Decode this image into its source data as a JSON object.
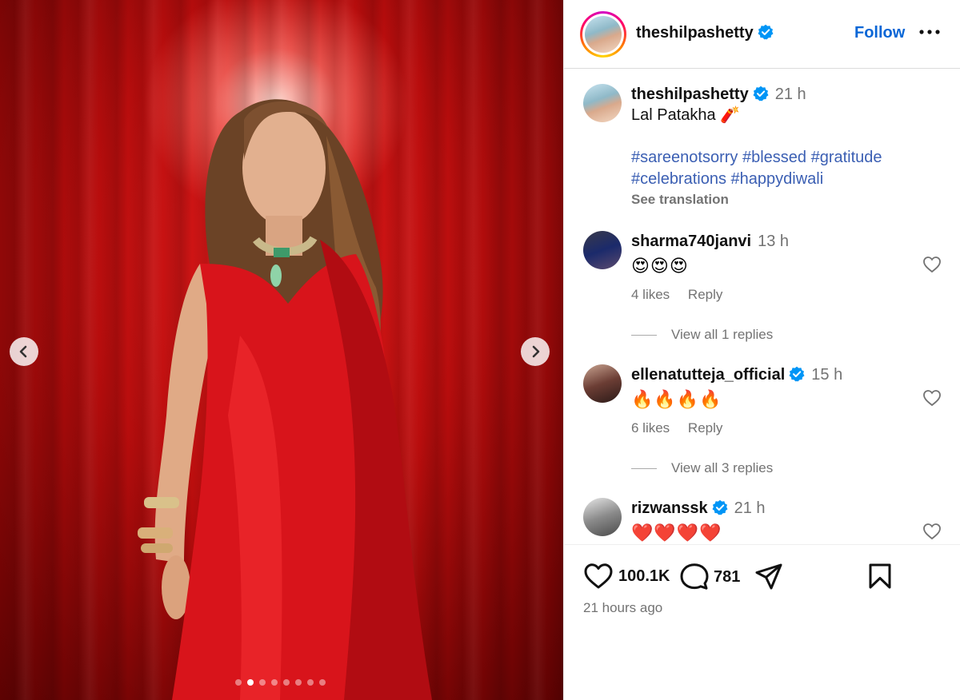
{
  "post": {
    "username": "theshilpashetty",
    "follow_label": "Follow",
    "caption": {
      "time": "21 h",
      "text": "Lal Patakha 🧨",
      "hashtags": [
        "#sareenotsorry",
        "#blessed",
        "#gratitude",
        "#celebrations",
        "#happydiwali"
      ],
      "see_translation": "See translation"
    },
    "carousel": {
      "total_slides": 8,
      "active_index": 1
    },
    "comments": [
      {
        "username": "sharma740janvi",
        "time": "13 h",
        "text": "😍😍😍",
        "likes": "4 likes",
        "reply": "Reply",
        "view_replies": "View all 1 replies"
      },
      {
        "username": "ellenatutteja_official",
        "time": "15 h",
        "text": "🔥🔥🔥🔥",
        "likes": "6 likes",
        "reply": "Reply",
        "view_replies": "View all 3 replies"
      },
      {
        "username": "rizwanssk",
        "time": "21 h",
        "text": "❤️❤️❤️❤️"
      }
    ],
    "like_count": "100.1K",
    "comment_count": "781",
    "time_ago": "21 hours ago"
  },
  "colors": {
    "follow_blue": "#0866d6",
    "hashtag_blue": "#3b5fb3",
    "verified_blue": "#0095f6",
    "muted_gray": "#737373"
  },
  "icons": [
    "chevron-left-icon",
    "chevron-right-icon",
    "verified-icon",
    "more-icon",
    "heart-icon",
    "comment-icon",
    "share-icon",
    "bookmark-icon"
  ]
}
